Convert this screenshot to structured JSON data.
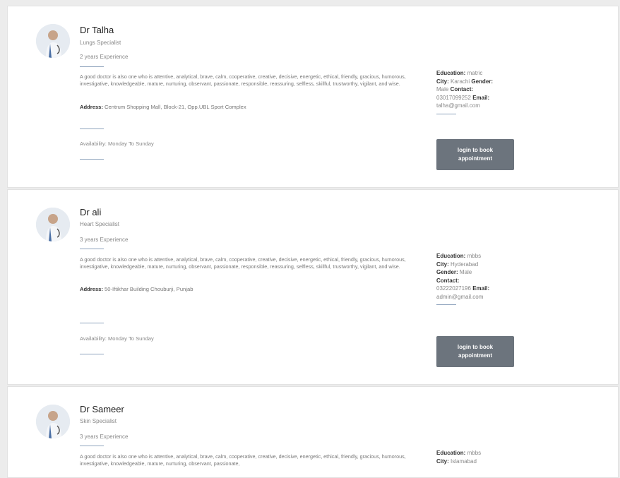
{
  "doctors": [
    {
      "name": "Dr Talha",
      "specialty": "Lungs Specialist",
      "experience": "2 years Experience",
      "description": "A good doctor is also one who is attentive, analytical, brave, calm, cooperative, creative, decisive, energetic, ethical, friendly, gracious, humorous, investigative, knowledgeable, mature, nurturing, observant, passionate, responsible, reassuring, selfless, skillful, trustworthy, vigilant, and wise.",
      "address_label": "Address:",
      "address": "Centrum Shopping Mall, Block-21, Opp.UBL Sport Complex",
      "availability": "Availability: Monday To Sunday",
      "education_label": "Education:",
      "education": "matric",
      "city_label": "City:",
      "city": "Karachi",
      "gender_label": "Gender:",
      "gender": "Male",
      "contact_label": "Contact:",
      "contact": "03017099252",
      "email_label": "Email:",
      "email": "talha@gmail.com",
      "button": "login to book appointment"
    },
    {
      "name": "Dr ali",
      "specialty": "Heart Specialist",
      "experience": "3 years Experience",
      "description": "A good doctor is also one who is attentive, analytical, brave, calm, cooperative, creative, decisive, energetic, ethical, friendly, gracious, humorous, investigative, knowledgeable, mature, nurturing, observant, passionate, responsible, reassuring, selfless, skillful, trustworthy, vigilant, and wise.",
      "address_label": "Address:",
      "address": "50-Iftikhar Building Chouburji, Punjab",
      "availability": "Availability: Monday To Sunday",
      "education_label": "Education:",
      "education": "mbbs",
      "city_label": "City:",
      "city": "Hyderabad",
      "gender_label": "Gender:",
      "gender": "Male",
      "contact_label": "Contact:",
      "contact": "03222027196",
      "email_label": "Email:",
      "email": "admin@gmail.com",
      "button": "login to book appointment"
    },
    {
      "name": "Dr Sameer",
      "specialty": "Skin Specialist",
      "experience": "3 years Experience",
      "description": "A good doctor is also one who is attentive, analytical, brave, calm, cooperative, creative, decisive, energetic, ethical, friendly, gracious, humorous, investigative, knowledgeable, mature, nurturing, observant, passionate,",
      "education_label": "Education:",
      "education": "mbbs",
      "city_label": "City:",
      "city": "Islamabad"
    }
  ]
}
